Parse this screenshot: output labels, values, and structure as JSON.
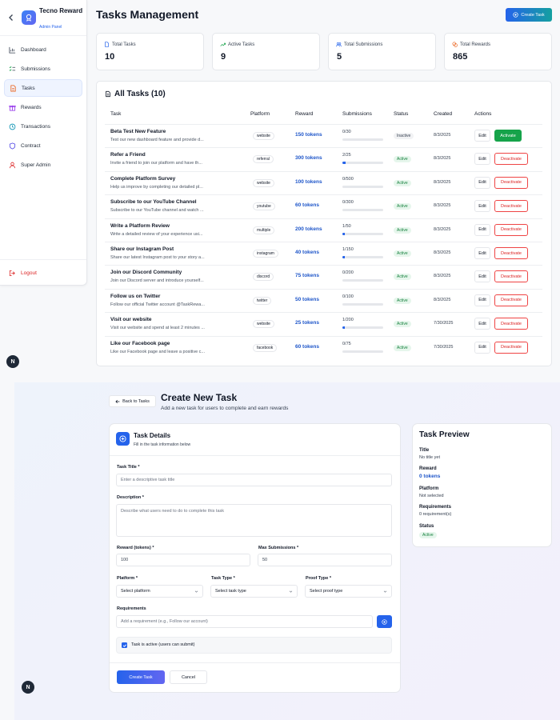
{
  "sidebar": {
    "brand": "Tecno Reward",
    "brand_sub": "Admin Panel",
    "items": [
      {
        "label": "Dashboard"
      },
      {
        "label": "Submissions"
      },
      {
        "label": "Tasks"
      },
      {
        "label": "Rewards"
      },
      {
        "label": "Transactions"
      },
      {
        "label": "Contract"
      },
      {
        "label": "Super Admin"
      }
    ],
    "logout": "Logout"
  },
  "header": {
    "title": "Tasks Management",
    "create_btn": "Create Task"
  },
  "stats": [
    {
      "label": "Total Tasks",
      "value": "10"
    },
    {
      "label": "Active Tasks",
      "value": "9"
    },
    {
      "label": "Total Submissions",
      "value": "5"
    },
    {
      "label": "Total Rewards",
      "value": "865"
    }
  ],
  "table": {
    "title": "All Tasks (10)",
    "columns": [
      "Task",
      "Platform",
      "Reward",
      "Submissions",
      "Status",
      "Created",
      "Actions"
    ],
    "edit_label": "Edit",
    "rows": [
      {
        "title": "Beta Test New Feature",
        "desc": "Test our new dashboard feature and provide d...",
        "platform": "website",
        "reward": "150 tokens",
        "subs": "0/30",
        "progress": 0,
        "status": "Inactive",
        "created": "8/3/2025",
        "action": "Activate"
      },
      {
        "title": "Refer a Friend",
        "desc": "Invite a friend to join our platform and have th...",
        "platform": "referral",
        "reward": "300 tokens",
        "subs": "2/25",
        "progress": 0.08,
        "status": "Active",
        "created": "8/3/2025",
        "action": "Deactivate"
      },
      {
        "title": "Complete Platform Survey",
        "desc": "Help us improve by completing our detailed pl...",
        "platform": "website",
        "reward": "100 tokens",
        "subs": "0/500",
        "progress": 0,
        "status": "Active",
        "created": "8/3/2025",
        "action": "Deactivate"
      },
      {
        "title": "Subscribe to our YouTube Channel",
        "desc": "Subscribe to our YouTube channel and watch ...",
        "platform": "youtube",
        "reward": "60 tokens",
        "subs": "0/300",
        "progress": 0,
        "status": "Active",
        "created": "8/3/2025",
        "action": "Deactivate"
      },
      {
        "title": "Write a Platform Review",
        "desc": "Write a detailed review of your experience usi...",
        "platform": "multiple",
        "reward": "200 tokens",
        "subs": "1/50",
        "progress": 0.02,
        "status": "Active",
        "created": "8/3/2025",
        "action": "Deactivate"
      },
      {
        "title": "Share our Instagram Post",
        "desc": "Share our latest Instagram post to your story a...",
        "platform": "instagram",
        "reward": "40 tokens",
        "subs": "1/150",
        "progress": 0.007,
        "status": "Active",
        "created": "8/3/2025",
        "action": "Deactivate"
      },
      {
        "title": "Join our Discord Community",
        "desc": "Join our Discord server and introduce yourself...",
        "platform": "discord",
        "reward": "75 tokens",
        "subs": "0/200",
        "progress": 0,
        "status": "Active",
        "created": "8/3/2025",
        "action": "Deactivate"
      },
      {
        "title": "Follow us on Twitter",
        "desc": "Follow our official Twitter account @TaskRewa...",
        "platform": "twitter",
        "reward": "50 tokens",
        "subs": "0/100",
        "progress": 0,
        "status": "Active",
        "created": "8/3/2025",
        "action": "Deactivate"
      },
      {
        "title": "Visit our website",
        "desc": "Visit our website and spend at least 2 minutes ...",
        "platform": "website",
        "reward": "25 tokens",
        "subs": "1/200",
        "progress": 0.005,
        "status": "Active",
        "created": "7/30/2025",
        "action": "Deactivate"
      },
      {
        "title": "Like our Facebook page",
        "desc": "Like our Facebook page and leave a positive c...",
        "platform": "facebook",
        "reward": "60 tokens",
        "subs": "0/75",
        "progress": 0,
        "status": "Active",
        "created": "7/30/2025",
        "action": "Deactivate"
      }
    ]
  },
  "form": {
    "back": "Back to Tasks",
    "title": "Create New Task",
    "subtitle": "Add a new task for users to complete and earn rewards",
    "card_title": "Task Details",
    "card_sub": "Fill in the task information below",
    "title_label": "Task Title *",
    "title_placeholder": "Enter a descriptive task title",
    "desc_label": "Description *",
    "desc_placeholder": "Describe what users need to do to complete this task",
    "reward_label": "Reward (tokens) *",
    "reward_value": "100",
    "max_label": "Max Submissions *",
    "max_value": "50",
    "platform_label": "Platform *",
    "platform_value": "Select platform",
    "type_label": "Task Type *",
    "type_value": "Select task type",
    "proof_label": "Proof Type *",
    "proof_value": "Select proof type",
    "req_label": "Requirements",
    "req_placeholder": "Add a requirement (e.g., Follow our account)",
    "active_label": "Task is active (users can submit)",
    "create_btn": "Create Task",
    "cancel_btn": "Cancel"
  },
  "preview": {
    "title": "Task Preview",
    "title_label": "Title",
    "title_value": "No title yet",
    "reward_label": "Reward",
    "reward_value": "0 tokens",
    "platform_label": "Platform",
    "platform_value": "Not selected",
    "req_label": "Requirements",
    "req_value": "0 requirement(s)",
    "status_label": "Status",
    "status_value": "Active"
  },
  "next_badge": "N"
}
